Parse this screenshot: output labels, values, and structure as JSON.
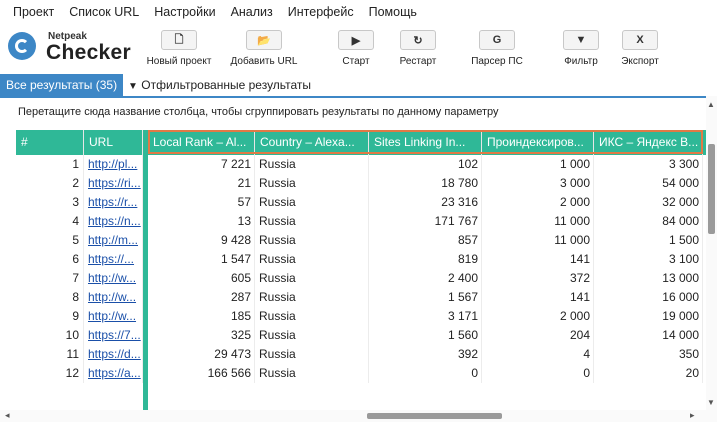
{
  "menu": [
    "Проект",
    "Список URL",
    "Настройки",
    "Анализ",
    "Интерфейс",
    "Помощь"
  ],
  "logo": {
    "small": "Netpeak",
    "big": "Checker"
  },
  "toolbar": [
    {
      "icon": "new-project-icon",
      "glyph": "🗋",
      "label": "Новый проект"
    },
    {
      "icon": "add-url-icon",
      "glyph": "📂",
      "label": "Добавить URL"
    },
    {
      "icon": "play-icon",
      "glyph": "▶",
      "label": "Старт"
    },
    {
      "icon": "restart-icon",
      "glyph": "↻",
      "label": "Рестарт"
    },
    {
      "icon": "google-icon",
      "glyph": "G",
      "label": "Парсер ПС"
    },
    {
      "icon": "filter-icon",
      "glyph": "▼",
      "label": "Фильтр"
    },
    {
      "icon": "export-icon",
      "glyph": "X",
      "label": "Экспорт"
    }
  ],
  "tabs": {
    "all": "Все результаты (35)",
    "filtered": "Отфильтрованные результаты",
    "filter_glyph": "▼"
  },
  "group_hint": "Перетащите сюда название столбца, чтобы сгруппировать результаты по данному параметру",
  "columns": [
    "#",
    "URL",
    "Local Rank – Al...",
    "Country – Alexa...",
    "Sites Linking In...",
    "Проиндексиров...",
    "ИКС – Яндекс В..."
  ],
  "rows": [
    [
      "1",
      "http://pl...",
      "7 221",
      "Russia",
      "102",
      "1 000",
      "3 300"
    ],
    [
      "2",
      "https://ri...",
      "21",
      "Russia",
      "18 780",
      "3 000",
      "54 000"
    ],
    [
      "3",
      "https://r...",
      "57",
      "Russia",
      "23 316",
      "2 000",
      "32 000"
    ],
    [
      "4",
      "https://n...",
      "13",
      "Russia",
      "171 767",
      "11 000",
      "84 000"
    ],
    [
      "5",
      "http://m...",
      "9 428",
      "Russia",
      "857",
      "11 000",
      "1 500"
    ],
    [
      "6",
      "https://...",
      "1 547",
      "Russia",
      "819",
      "141",
      "3 100"
    ],
    [
      "7",
      "http://w...",
      "605",
      "Russia",
      "2 400",
      "372",
      "13 000"
    ],
    [
      "8",
      "http://w...",
      "287",
      "Russia",
      "1 567",
      "141",
      "16 000"
    ],
    [
      "9",
      "http://w...",
      "185",
      "Russia",
      "3 171",
      "2 000",
      "19 000"
    ],
    [
      "10",
      "https://7...",
      "325",
      "Russia",
      "1 560",
      "204",
      "14 000"
    ],
    [
      "11",
      "https://d...",
      "29 473",
      "Russia",
      "392",
      "4",
      "350"
    ],
    [
      "12",
      "https://a...",
      "166 566",
      "Russia",
      "0",
      "0",
      "20"
    ]
  ],
  "colors": {
    "accent": "#3d87c6",
    "header": "#2fb897",
    "highlight": "#e07a46",
    "link": "#1a4fa8"
  }
}
